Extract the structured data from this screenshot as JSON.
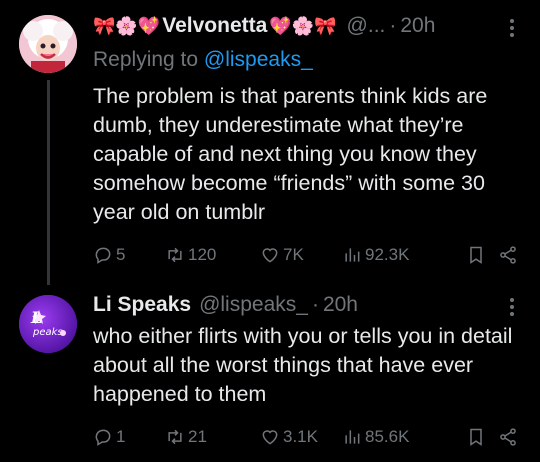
{
  "tweets": [
    {
      "display_name_prefix": "🎀🌸💖",
      "display_name": "Velvonetta",
      "display_name_suffix": "💖🌸🎀",
      "handle": "@...",
      "dot": "·",
      "time": "20h",
      "replying_prefix": "Replying to ",
      "replying_to": "@lispeaks_",
      "text": "The problem is that parents think kids are dumb, they underestimate what they’re capable of and next thing you know they somehow become “friends” with some 30 year old on tumblr",
      "replies": "5",
      "retweets": "120",
      "likes": "7K",
      "views": "92.3K"
    },
    {
      "display_name": "Li Speaks",
      "handle": "@lispeaks_",
      "dot": "·",
      "time": "20h",
      "avatar_text": "peaks",
      "text": "who either flirts with you or tells you in detail about all the worst things that have ever happened to them",
      "replies": "1",
      "retweets": "21",
      "likes": "3.1K",
      "views": "85.6K"
    }
  ],
  "colors": {
    "background": "#000000",
    "text": "#e7e9ea",
    "secondary": "#71767b",
    "link": "#1d9bf0",
    "thread_line": "#333639"
  },
  "icons": [
    "reply-icon",
    "retweet-icon",
    "like-icon",
    "views-icon",
    "bookmark-icon",
    "share-icon",
    "more-icon"
  ]
}
